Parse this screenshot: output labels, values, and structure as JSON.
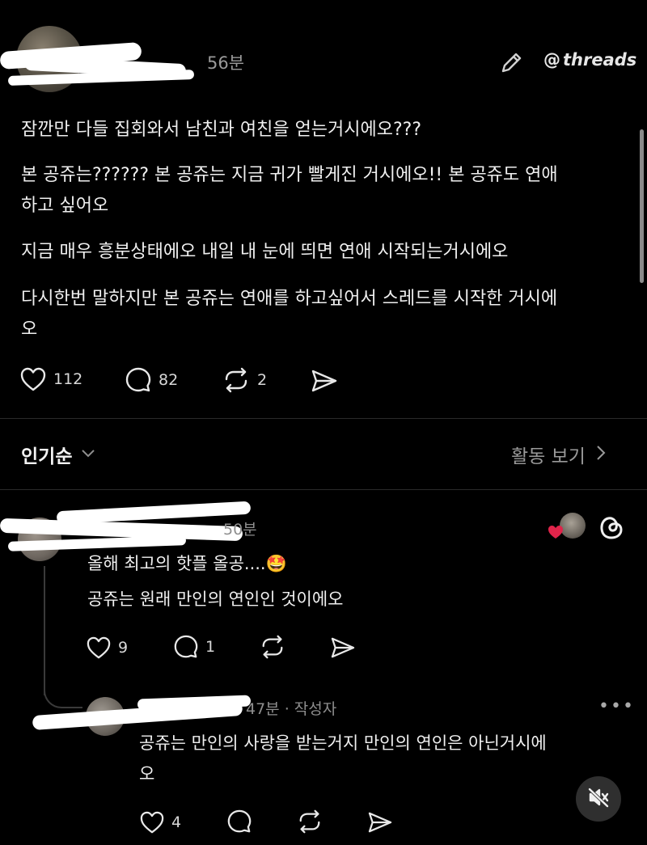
{
  "post": {
    "time": "56분",
    "brand": "threads",
    "paragraphs": [
      "잠깐만 다들 집회와서 남친과 여친을 얻는거시에오???",
      "본 공쥬는?????? 본 공쥬는 지금 귀가 빨게진 거시에오!! 본 공쥬도 연애",
      "하고 싶어오",
      "지금 매우 흥분상태에오 내일 내 눈에 띄면 연애 시작되는거시에오",
      "다시한번 말하지만 본 공쥬는 연애를 하고싶어서 스레드를 시작한 거시에",
      "오"
    ],
    "likes": "112",
    "comments": "82",
    "reposts": "2"
  },
  "sort": {
    "label": "인기순",
    "activity_label": "활동 보기"
  },
  "reply1": {
    "time": "50분",
    "lines": [
      "올해 최고의 핫플 올공....🤩",
      "공쥬는 원래 만인의 연인인 것이에오"
    ],
    "likes": "9",
    "comments": "1"
  },
  "reply2": {
    "time": "47분 · 작성자",
    "lines": [
      "공쥬는 만인의 사랑을 받는거지 만인의 연인은 아닌거시에",
      "오"
    ],
    "likes": "4"
  },
  "icons": {
    "heart": "heart-icon",
    "comment": "comment-icon",
    "repost": "repost-icon",
    "share": "share-icon",
    "edit": "pencil-icon",
    "mute": "speaker-muted-icon"
  },
  "colors": {
    "background": "#000000",
    "text": "#f0f0f0",
    "muted": "#8e8e8e",
    "like_red": "#e0244a"
  }
}
